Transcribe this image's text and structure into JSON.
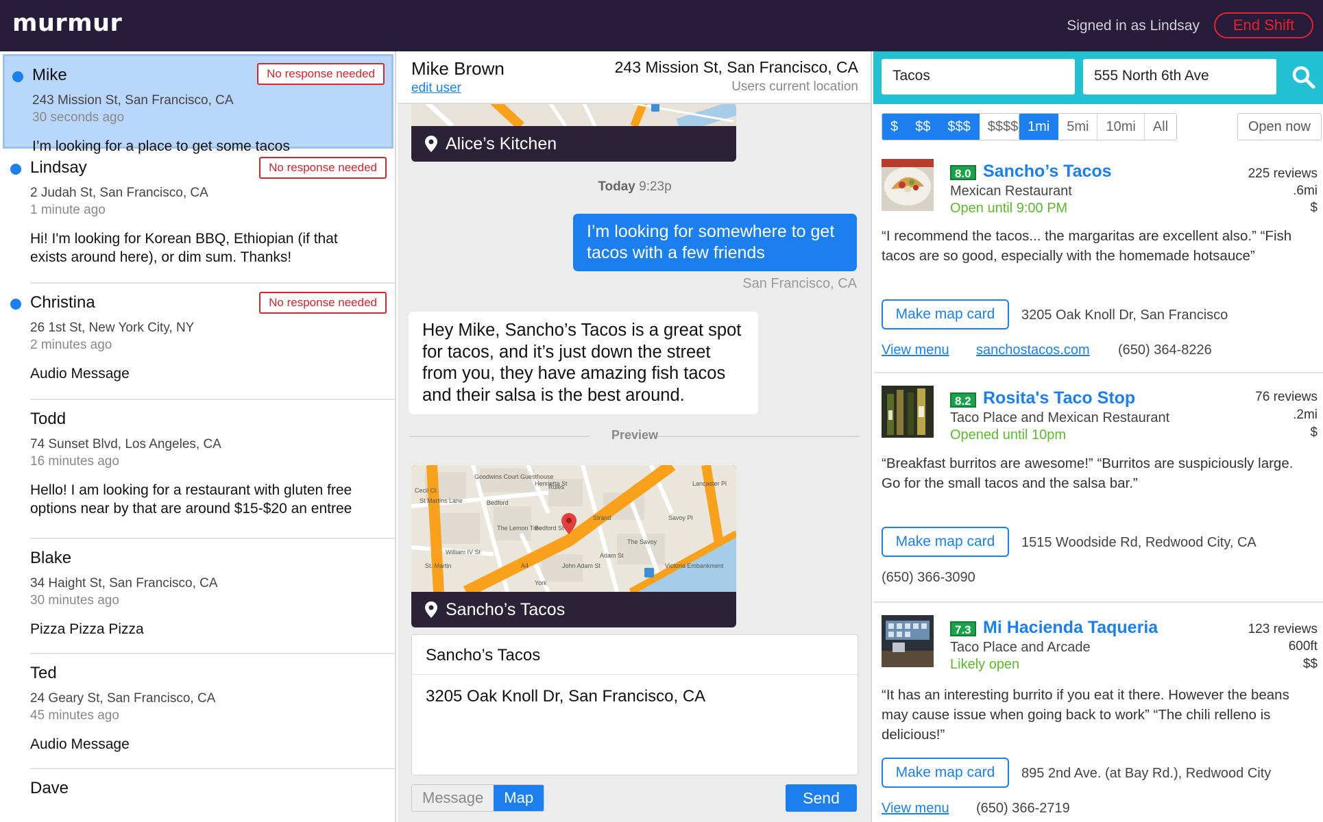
{
  "app": {
    "logo": "murmur",
    "signed_in": "Signed in as Lindsay",
    "end_shift": "End Shift"
  },
  "conversations": [
    {
      "name": "Mike",
      "address": "243 Mission St, San Francisco, CA",
      "time": "30 seconds ago",
      "message": "I’m looking for a place to get some tacos",
      "badge": "No response needed",
      "unread": true,
      "selected": true
    },
    {
      "name": "Lindsay",
      "address": "2 Judah St, San Francisco, CA",
      "time": "1 minute ago",
      "message": "Hi! I'm looking for Korean BBQ, Ethiopian (if that exists around here), or dim sum. Thanks!",
      "badge": "No response needed",
      "unread": true
    },
    {
      "name": "Christina",
      "address": "26 1st St, New York City, NY",
      "time": "2 minutes ago",
      "message": "Audio Message",
      "badge": "No response needed",
      "unread": true
    },
    {
      "name": "Todd",
      "address": "74 Sunset Blvd, Los Angeles, CA",
      "time": "16 minutes ago",
      "message": "Hello! I am looking for a restaurant with gluten free options near by that are around $15-$20 an entree"
    },
    {
      "name": "Blake",
      "address": "34 Haight St, San Francisco, CA",
      "time": "30 minutes ago",
      "message": "Pizza Pizza Pizza"
    },
    {
      "name": "Ted",
      "address": "24 Geary St, San Francisco, CA",
      "time": "45 minutes ago",
      "message": "Audio Message"
    },
    {
      "name": "Dave",
      "address": "",
      "time": "",
      "message": ""
    }
  ],
  "chat": {
    "user_name": "Mike Brown",
    "edit_user": "edit user",
    "address": "243 Mission St, San Francisco, CA",
    "location_label": "Users current location",
    "prev_card_title": "Alice’s Kitchen",
    "day": "Today",
    "day_time": "9:23p",
    "outgoing": "I’m looking for somewhere to get tacos with a few friends",
    "outgoing_location": "San Francisco, CA",
    "incoming": "Hey Mike, Sancho’s Tacos is a great spot for tacos, and it’s just down the street from you, they have amazing fish tacos and their salsa is the best around.",
    "preview_label": "Preview",
    "preview_card_title": "Sancho’s Tacos",
    "compose_name": "Sancho’s Tacos",
    "compose_address": "3205 Oak Knoll Dr, San Francisco, CA",
    "toggle": [
      "Message",
      "Map"
    ],
    "toggle_selected": "Map",
    "send": "Send",
    "map_street_labels": [
      "Goodwins Court Guesthouse",
      "Henrietta St",
      "Rules",
      "Cecil Ct",
      "St Martins Lane",
      "Bedford",
      "The Lemon Tree",
      "Bedford St",
      "Strand",
      "The Savoy",
      "Savoy Pl",
      "Lancaster Pl",
      "William IV St",
      "St. Martin",
      "A4",
      "John Adam St",
      "Adam St",
      "Victoria Embankment",
      "York"
    ]
  },
  "search": {
    "query": "Tacos",
    "location": "555 North 6th Ave",
    "price_filters": [
      "$",
      "$$",
      "$$$",
      "$$$$"
    ],
    "price_selected": [
      "$",
      "$$",
      "$$$"
    ],
    "distance_filters": [
      "1mi",
      "5mi",
      "10mi",
      "All"
    ],
    "distance_selected": "1mi",
    "open_now": "Open now"
  },
  "results": [
    {
      "score": "8.0",
      "name": "Sancho’s Tacos",
      "type": "Mexican Restaurant",
      "hours": "Open until 9:00 PM",
      "reviews": "225 reviews",
      "distance": ".6mi",
      "price": "$",
      "quotes": "“I recommend the tacos... the margaritas are excellent also.” “Fish tacos are so good, especially with the homemade hotsauce”",
      "map_button": "Make map card",
      "address": "3205 Oak Knoll Dr, San Francisco",
      "menu": "View menu",
      "website": "sanchostacos.com",
      "phone": "(650) 364-8226"
    },
    {
      "score": "8.2",
      "name": "Rosita's Taco Stop",
      "type": "Taco Place and Mexican Restaurant",
      "hours": "Opened until 10pm",
      "reviews": "76 reviews",
      "distance": ".2mi",
      "price": "$",
      "quotes": "“Breakfast burritos are awesome!” “Burritos are suspiciously large. Go for the small tacos and the salsa bar.”",
      "map_button": "Make map card",
      "address": "1515 Woodside Rd, Redwood City, CA",
      "phone": "(650) 366-3090"
    },
    {
      "score": "7.3",
      "name": "Mi Hacienda Taqueria",
      "type": "Taco Place and Arcade",
      "hours": "Likely open",
      "reviews": "123 reviews",
      "distance": "600ft",
      "price": "$$",
      "quotes": "“It has an interesting burrito if you eat it there. However the beans may cause issue when going back to work” “The chili relleno is delicious!”",
      "map_button": "Make map card",
      "address": "895 2nd Ave. (at Bay Rd.), Redwood City",
      "menu": "View menu",
      "phone": "(650) 366-2719"
    }
  ],
  "colors": {
    "topbar": "#271d3b",
    "accent": "#1b7ff0",
    "search_bar": "#23c1d3",
    "alert": "#d0262d",
    "open_green": "#5cb82c",
    "score_green": "#1aa34a"
  }
}
